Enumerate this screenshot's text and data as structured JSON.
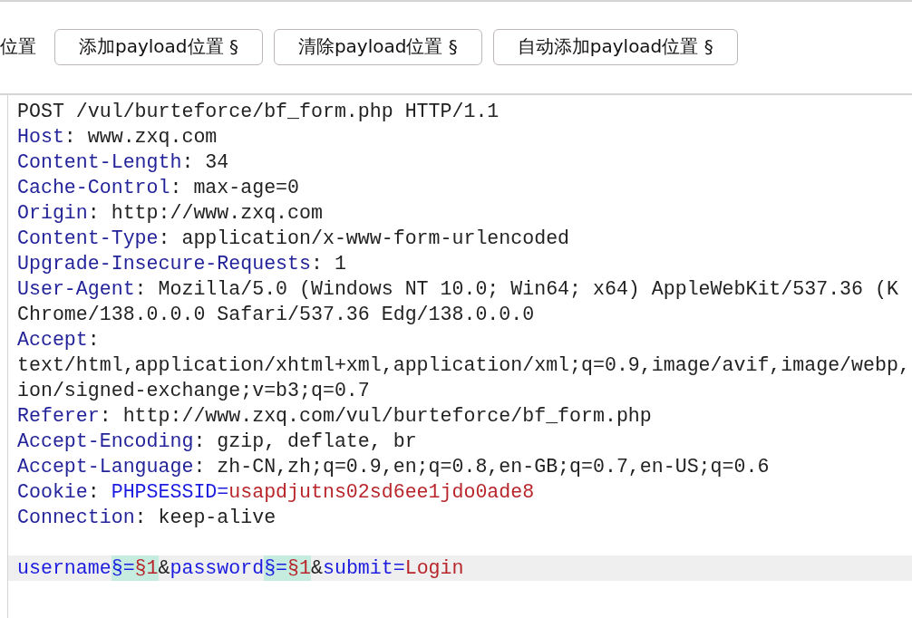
{
  "toolbar": {
    "label": "位置",
    "buttons": [
      "添加payload位置 §",
      "清除payload位置 §",
      "自动添加payload位置 §"
    ]
  },
  "lines": [
    {
      "selected": false,
      "segments": [
        {
          "text": "POST /vul/burteforce/bf_form.php HTTP/1.1",
          "kind": "plain"
        }
      ]
    },
    {
      "selected": false,
      "segments": [
        {
          "text": "Host",
          "kind": "key"
        },
        {
          "text": ": www.zxq.com",
          "kind": "plain"
        }
      ]
    },
    {
      "selected": false,
      "segments": [
        {
          "text": "Content-Length",
          "kind": "key"
        },
        {
          "text": ": 34",
          "kind": "plain"
        }
      ]
    },
    {
      "selected": false,
      "segments": [
        {
          "text": "Cache-Control",
          "kind": "key"
        },
        {
          "text": ": max-age=0",
          "kind": "plain"
        }
      ]
    },
    {
      "selected": false,
      "segments": [
        {
          "text": "Origin",
          "kind": "key"
        },
        {
          "text": ": http://www.zxq.com",
          "kind": "plain"
        }
      ]
    },
    {
      "selected": false,
      "segments": [
        {
          "text": "Content-Type",
          "kind": "key"
        },
        {
          "text": ": application/x-www-form-urlencoded",
          "kind": "plain"
        }
      ]
    },
    {
      "selected": false,
      "segments": [
        {
          "text": "Upgrade-Insecure-Requests",
          "kind": "key"
        },
        {
          "text": ": 1",
          "kind": "plain"
        }
      ]
    },
    {
      "selected": false,
      "segments": [
        {
          "text": "User-Agent",
          "kind": "key"
        },
        {
          "text": ": Mozilla/5.0 (Windows NT 10.0; Win64; x64) AppleWebKit/537.36 (K",
          "kind": "plain"
        }
      ]
    },
    {
      "selected": false,
      "segments": [
        {
          "text": "Chrome/138.0.0.0 Safari/537.36 Edg/138.0.0.0",
          "kind": "plain"
        }
      ]
    },
    {
      "selected": false,
      "segments": [
        {
          "text": "Accept",
          "kind": "key"
        },
        {
          "text": ":",
          "kind": "plain"
        }
      ]
    },
    {
      "selected": false,
      "segments": [
        {
          "text": "text/html,application/xhtml+xml,application/xml;q=0.9,image/avif,image/webp,",
          "kind": "plain"
        }
      ]
    },
    {
      "selected": false,
      "segments": [
        {
          "text": "ion/signed-exchange;v=b3;q=0.7",
          "kind": "plain"
        }
      ]
    },
    {
      "selected": false,
      "segments": [
        {
          "text": "Referer",
          "kind": "key"
        },
        {
          "text": ": http://www.zxq.com/vul/burteforce/bf_form.php",
          "kind": "plain"
        }
      ]
    },
    {
      "selected": false,
      "segments": [
        {
          "text": "Accept-Encoding",
          "kind": "key"
        },
        {
          "text": ": gzip, deflate, br",
          "kind": "plain"
        }
      ]
    },
    {
      "selected": false,
      "segments": [
        {
          "text": "Accept-Language",
          "kind": "key"
        },
        {
          "text": ": zh-CN,zh;q=0.9,en;q=0.8,en-GB;q=0.7,en-US;q=0.6",
          "kind": "plain"
        }
      ]
    },
    {
      "selected": false,
      "segments": [
        {
          "text": "Cookie",
          "kind": "key"
        },
        {
          "text": ": ",
          "kind": "plain"
        },
        {
          "text": "PHPSESSID=",
          "kind": "param"
        },
        {
          "text": "usapdjutns02sd6ee1jdo0ade8",
          "kind": "value"
        }
      ]
    },
    {
      "selected": false,
      "segments": [
        {
          "text": "Connection",
          "kind": "key"
        },
        {
          "text": ": keep-alive",
          "kind": "plain"
        }
      ]
    },
    {
      "selected": false
    },
    {
      "selected": true,
      "segments": [
        {
          "text": "username",
          "kind": "param"
        },
        {
          "text": "§=",
          "kind": "markparam"
        },
        {
          "text": "§1",
          "kind": "markvalue"
        },
        {
          "text": "&",
          "kind": "plain"
        },
        {
          "text": "password",
          "kind": "param"
        },
        {
          "text": "§=",
          "kind": "markparam"
        },
        {
          "text": "§1",
          "kind": "markvalue"
        },
        {
          "text": "&",
          "kind": "plain"
        },
        {
          "text": "submit=",
          "kind": "param"
        },
        {
          "text": "Login",
          "kind": "value"
        }
      ]
    }
  ]
}
